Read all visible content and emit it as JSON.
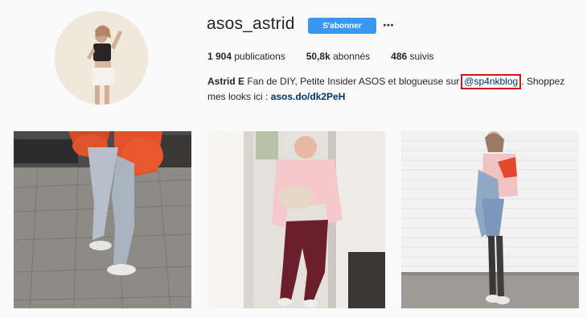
{
  "profile": {
    "username": "asos_astrid",
    "follow_label": "S'abonner",
    "more_icon": "⋯"
  },
  "stats": {
    "publications_count": "1 904",
    "publications_label": "publications",
    "followers_count": "50,8k",
    "followers_label": "abonnés",
    "following_count": "486",
    "following_label": "suivis"
  },
  "bio": {
    "name": "Astrid E",
    "text_before": " Fan de DIY, Petite Insider ASOS et blogueuse sur",
    "handle": "@sp4nkblog",
    "text_after": ". Shoppez mes looks ici : ",
    "link": "asos.do/dk2PeH"
  },
  "colors": {
    "follow_button": "#3897f0",
    "highlight_box": "#d0151b",
    "link": "#003569"
  }
}
